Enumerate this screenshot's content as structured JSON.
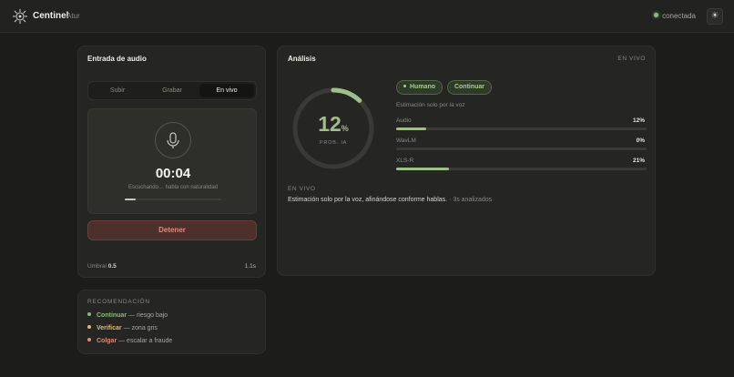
{
  "header": {
    "brand": "Centinel",
    "sub": "Atur",
    "status": "conectada",
    "theme_icon": "sun-icon"
  },
  "audio": {
    "title": "Entrada de audio",
    "tabs": [
      "Subir",
      "Grabar",
      "En vivo"
    ],
    "active_tab": "En vivo",
    "timer": "00:04",
    "listening": "Escuchando… habla con naturalidad",
    "input_level": 0.11,
    "stop_label": "Detener",
    "threshold_label": "Umbral",
    "threshold_value": "0.5",
    "latency": "1.1s"
  },
  "recommendation": {
    "title": "RECOMENDACIÓN",
    "items": [
      {
        "action": "Continuar",
        "desc": " — riesgo bajo",
        "color": "#8fb87a"
      },
      {
        "action": "Verificar",
        "desc": " — zona gris",
        "color": "#e0b86a"
      },
      {
        "action": "Colgar",
        "desc": " — escalar a fraude",
        "color": "#e08a7c"
      }
    ]
  },
  "analysis": {
    "title": "Análisis",
    "live_tag": "EN VIVO",
    "prob_value": "12",
    "prob_unit": "%",
    "prob_fraction": 0.12,
    "prob_label": "PROB. IA",
    "verdict": "Humano",
    "action": "Continuar",
    "estimate_note": "Estimación solo por la voz",
    "metrics": [
      {
        "name": "Audio",
        "value": "12%",
        "fraction": 0.12
      },
      {
        "name": "WavLM",
        "value": "0%",
        "fraction": 0.0
      },
      {
        "name": "XLS-R",
        "value": "21%",
        "fraction": 0.21
      }
    ],
    "live_label": "EN VIVO",
    "summary": "Estimación solo por la voz, afinándose conforme hablas.",
    "summary_meta": " · 3s analizados"
  },
  "colors": {
    "accent_green": "#9fbf8a",
    "danger": "#e08a7c"
  }
}
